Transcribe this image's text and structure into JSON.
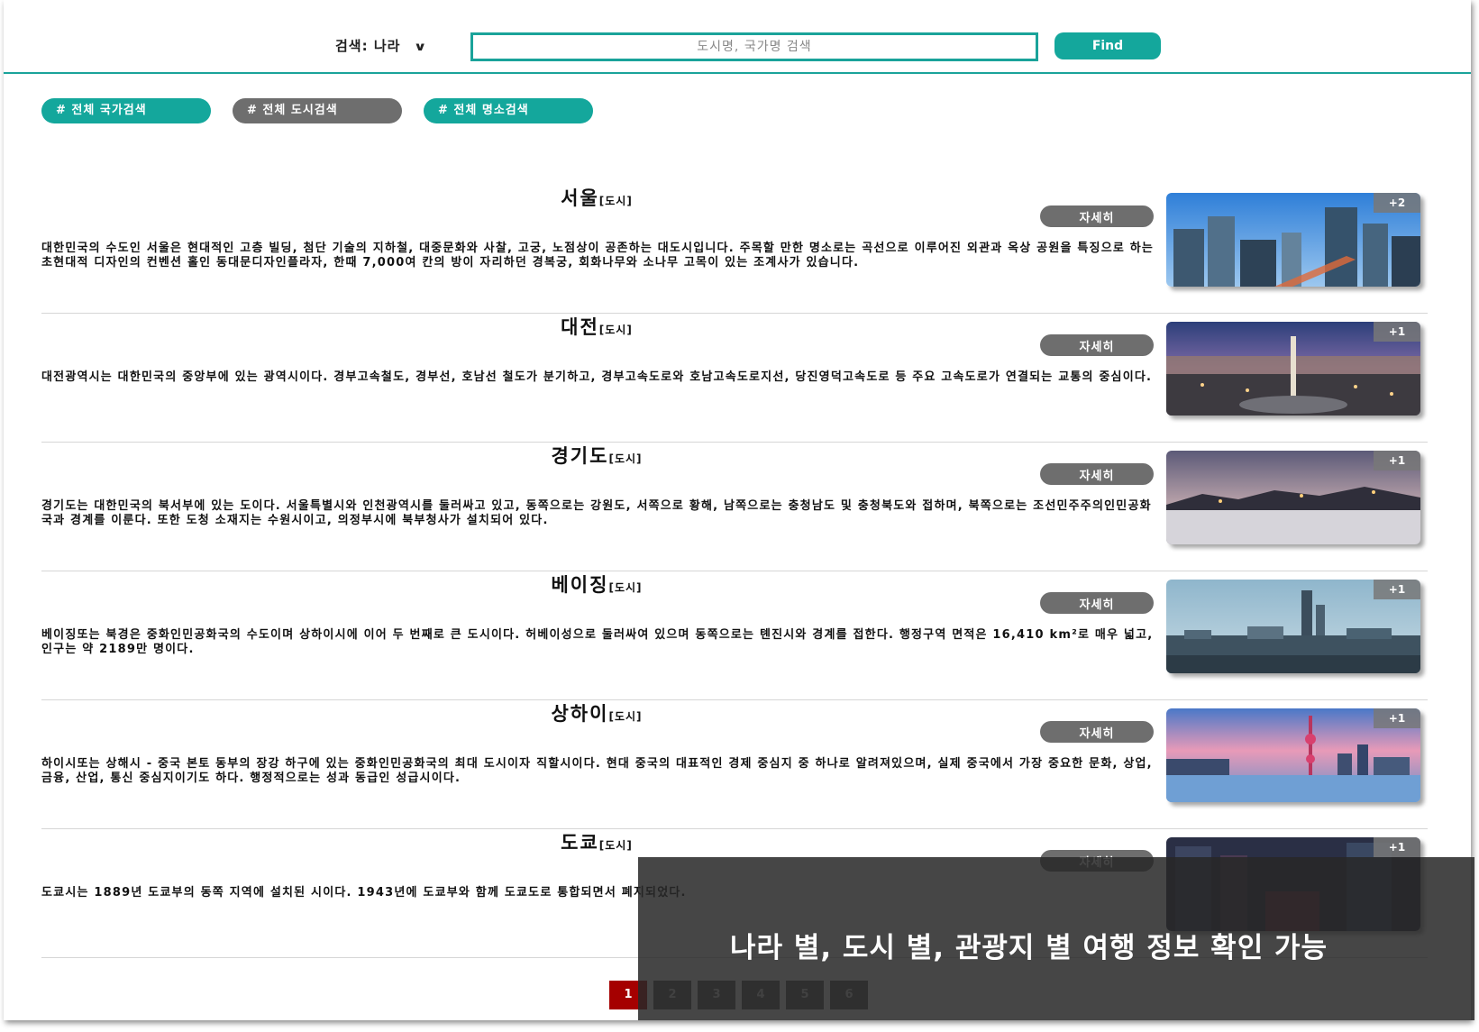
{
  "search": {
    "scope_label": "검색: 나라",
    "placeholder": "도시명, 국가명 검색",
    "value": "",
    "button_label": "Find"
  },
  "tags": [
    {
      "label": "# 전체 국가검색"
    },
    {
      "label": "# 전체 도시검색"
    },
    {
      "label": "# 전체 명소검색"
    }
  ],
  "entries": [
    {
      "name": "서울",
      "category": "[도시]",
      "detail_label": "자세히",
      "photo_count": "+2",
      "description": "대한민국의 수도인 서울은 현대적인 고층 빌딩, 첨단 기술의 지하철, 대중문화와 사찰, 고궁, 노점상이 공존하는 대도시입니다. 주목할 만한 명소로는 곡선으로 이루어진 외관과 옥상 공원을 특징으로 하는 초현대적 디자인의 컨벤션 홀인 동대문디자인플라자, 한때 7,000여 칸의 방이 자리하던 경복궁, 회화나무와 소나무 고목이 있는 조계사가 있습니다."
    },
    {
      "name": "대전",
      "category": "[도시]",
      "detail_label": "자세히",
      "photo_count": "+1",
      "description": "대전광역시는 대한민국의 중앙부에 있는 광역시이다. 경부고속철도, 경부선, 호남선 철도가 분기하고, 경부고속도로와 호남고속도로지선, 당진영덕고속도로 등 주요 고속도로가 연결되는 교통의 중심이다."
    },
    {
      "name": "경기도",
      "category": "[도시]",
      "detail_label": "자세히",
      "photo_count": "+1",
      "description": "경기도는 대한민국의 북서부에 있는 도이다. 서울특별시와 인천광역시를 둘러싸고 있고, 동쪽으로는 강원도, 서쪽으로 황해, 남쪽으로는 충청남도 및 충청북도와 접하며, 북쪽으로는 조선민주주의인민공화국과 경계를 이룬다. 또한 도청 소재지는 수원시이고, 의정부시에 북부청사가 설치되어 있다."
    },
    {
      "name": "베이징",
      "category": "[도시]",
      "detail_label": "자세히",
      "photo_count": "+1",
      "description": "베이징또는 북경은 중화인민공화국의 수도이며 상하이시에 이어 두 번째로 큰 도시이다. 허베이성으로 둘러싸여 있으며 동쪽으로는 톈진시와 경계를 접한다. 행정구역 면적은 16,410 km²로 매우 넓고, 인구는 약 2189만 명이다."
    },
    {
      "name": "상하이",
      "category": "[도시]",
      "detail_label": "자세히",
      "photo_count": "+1",
      "description": "하이시또는 상해시 - 중국 본토 동부의 장강 하구에 있는 중화인민공화국의 최대 도시이자 직할시이다. 현대 중국의 대표적인 경제 중심지 중 하나로 알려져있으며, 실제 중국에서 가장 중요한 문화, 상업, 금융, 산업, 통신 중심지이기도 하다. 행정적으로는 성과 동급인 성급시이다."
    },
    {
      "name": "도쿄",
      "category": "[도시]",
      "detail_label": "자세히",
      "photo_count": "+1",
      "description": "도쿄시는 1889년 도쿄부의 동쪽 지역에 설치된 시이다. 1943년에 도쿄부와 함께 도쿄도로 통합되면서 폐지되었다."
    }
  ],
  "pagination": {
    "pages": [
      "1",
      "2",
      "3",
      "4",
      "5",
      "6"
    ],
    "current": "1"
  },
  "overlay_caption": "나라 별, 도시 별, 관광지 별 여행 정보 확인 가능",
  "colors": {
    "accent": "#14a79c",
    "tag_gray": "#6e6e6e",
    "pager_active": "#a50000",
    "pager": "#5c5c5c"
  }
}
